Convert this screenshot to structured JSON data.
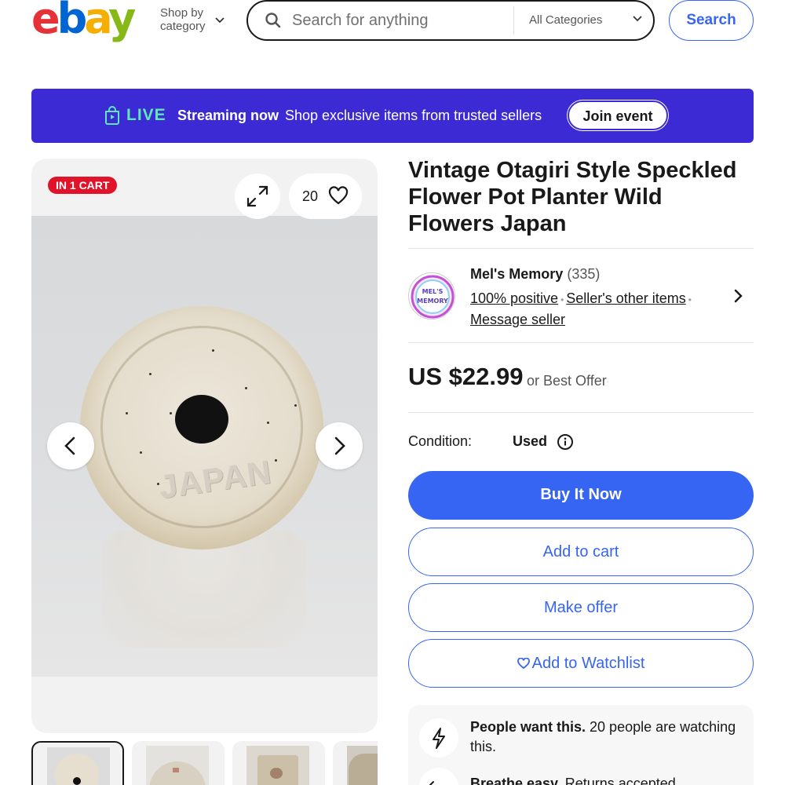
{
  "header": {
    "logo": {
      "e": "e",
      "b": "b",
      "a": "a",
      "y": "y"
    },
    "shop_by_line1": "Shop by",
    "shop_by_line2": "category",
    "search_placeholder": "Search for anything",
    "category": "All Categories",
    "search_button": "Search"
  },
  "live_banner": {
    "live_label": "LIVE",
    "streaming": "Streaming now",
    "message": "Shop exclusive items from trusted sellers",
    "join_button": "Join event",
    "background": "#3c2ad4"
  },
  "gallery": {
    "cart_badge": "IN 1 CART",
    "watch_count": "20",
    "photo_text": "JAPAN",
    "thumbnail_count_visible": 4,
    "selected_thumbnail": 1
  },
  "listing": {
    "title": "Vintage Otagiri Style Speckled Flower Pot Planter Wild Flowers Japan",
    "seller": {
      "name": "Mel's Memory",
      "feedback_count": "(335)",
      "positive": "100% positive",
      "other_items": "Seller's other items",
      "message": "Message seller",
      "avatar_text_1": "MEL'S",
      "avatar_text_2": "MEMORY"
    },
    "price": "US $22.99",
    "best_offer": "or Best Offer",
    "condition_label": "Condition:",
    "condition_value": "Used",
    "buttons": {
      "buy_now": "Buy It Now",
      "add_to_cart": "Add to cart",
      "make_offer": "Make offer",
      "watchlist": "Add to Watchlist"
    },
    "signals": {
      "people_want_bold": "People want this.",
      "people_want_rest": " 20 people are watching this.",
      "breathe_bold": "Breathe easy.",
      "breathe_rest": " Returns accepted."
    }
  },
  "colors": {
    "accent": "#3665f3",
    "badge": "#e0132a",
    "live_green": "#5ee8b5"
  }
}
